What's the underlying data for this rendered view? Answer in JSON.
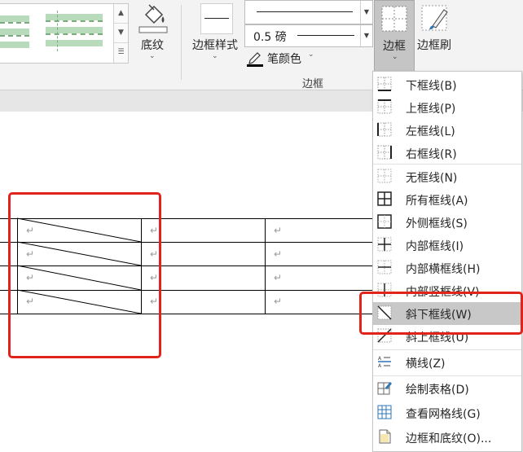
{
  "ribbon": {
    "shading_label": "底纹",
    "border_styles_label": "边框样式",
    "line_weight_value": "0.5 磅",
    "pen_color_label": "笔颜色",
    "borders_label": "边框",
    "border_painter_label": "边框刷",
    "group_label": "边框"
  },
  "table": {
    "paragraph_mark": "↵"
  },
  "menu": {
    "items": [
      {
        "label": "下框线(B)",
        "icon": "bottom-border-icon"
      },
      {
        "label": "上框线(P)",
        "icon": "top-border-icon"
      },
      {
        "label": "左框线(L)",
        "icon": "left-border-icon"
      },
      {
        "label": "右框线(R)",
        "icon": "right-border-icon"
      },
      {
        "label": "无框线(N)",
        "icon": "no-border-icon"
      },
      {
        "label": "所有框线(A)",
        "icon": "all-borders-icon"
      },
      {
        "label": "外侧框线(S)",
        "icon": "outside-borders-icon"
      },
      {
        "label": "内部框线(I)",
        "icon": "inside-borders-icon"
      },
      {
        "label": "内部横框线(H)",
        "icon": "inside-horizontal-border-icon"
      },
      {
        "label": "内部竖框线(V)",
        "icon": "inside-vertical-border-icon"
      },
      {
        "label": "斜下框线(W)",
        "icon": "diagonal-down-border-icon"
      },
      {
        "label": "斜上框线(U)",
        "icon": "diagonal-up-border-icon"
      },
      {
        "label": "横线(Z)",
        "icon": "horizontal-line-icon"
      },
      {
        "label": "绘制表格(D)",
        "icon": "draw-table-icon"
      },
      {
        "label": "查看网格线(G)",
        "icon": "view-gridlines-icon"
      },
      {
        "label": "边框和底纹(O)...",
        "icon": "borders-shading-icon"
      }
    ],
    "highlighted_index": 10
  },
  "colors": {
    "highlight_box": "#e2231a",
    "menu_highlight": "#c8c8c8",
    "gallery_green": "#b7dbbb"
  }
}
